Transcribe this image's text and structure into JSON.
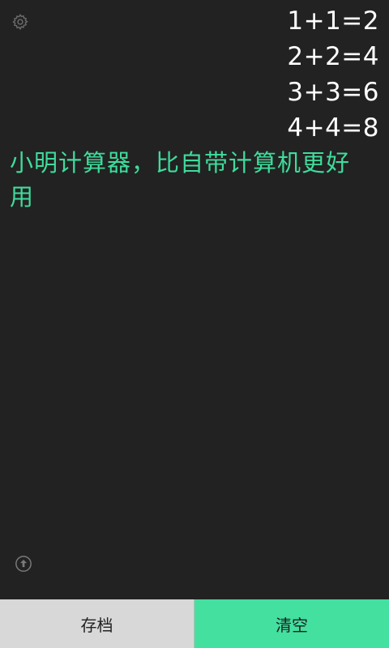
{
  "icons": {
    "settings": "gear-icon",
    "upload": "arrow-up-circle-icon"
  },
  "history": [
    "1+1=2",
    "2+2=4",
    "3+3=6",
    "4+4=8"
  ],
  "input": {
    "text": "小明计算器，比自带计算机更好用"
  },
  "bottom_bar": {
    "save_label": "存档",
    "clear_label": "清空"
  },
  "colors": {
    "background": "#222222",
    "accent": "#43e0a0",
    "input_text": "#3fdc9c",
    "save_bg": "#d8d8d8"
  }
}
